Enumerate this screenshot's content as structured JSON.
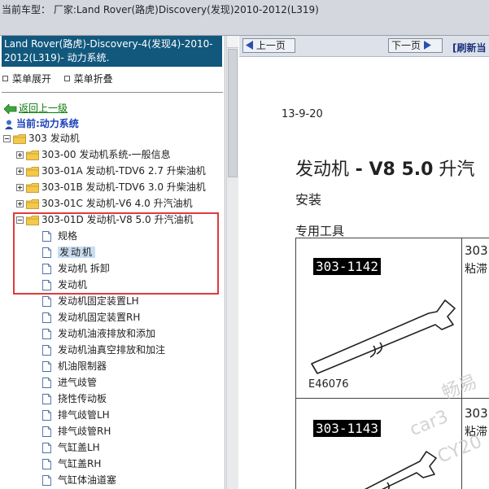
{
  "topbar": {
    "vehicle_label": "当前车型：  厂家:Land Rover(路虎)Discovery(发现)2010-2012(L319)"
  },
  "left_panel": {
    "title": "Land Rover(路虎)-Discovery-4(发现4)-2010-2012(L319)- 动力系统.",
    "expand_label": "菜单展开",
    "collapse_label": "菜单折叠",
    "back_label": "返回上一级",
    "current_label": "当前:动力系统",
    "tree": [
      {
        "label": "303 发动机",
        "level": 0,
        "kind": "folder",
        "expanded": true
      },
      {
        "label": "303-00 发动机系统-一般信息",
        "level": 1,
        "kind": "folder",
        "expanded": false
      },
      {
        "label": "303-01A 发动机-TDV6 2.7 升柴油机",
        "level": 1,
        "kind": "folder",
        "expanded": false
      },
      {
        "label": "303-01B 发动机-TDV6 3.0 升柴油机",
        "level": 1,
        "kind": "folder",
        "expanded": false
      },
      {
        "label": "303-01C 发动机-V6 4.0 升汽油机",
        "level": 1,
        "kind": "folder",
        "expanded": false
      },
      {
        "label": "303-01D 发动机-V8 5.0 升汽油机",
        "level": 1,
        "kind": "folder",
        "expanded": true
      },
      {
        "label": "规格",
        "level": 2,
        "kind": "page"
      },
      {
        "label": "发动机",
        "level": 2,
        "kind": "page",
        "selected": true
      },
      {
        "label": "发动机 拆卸",
        "level": 2,
        "kind": "page"
      },
      {
        "label": "发动机",
        "level": 2,
        "kind": "page"
      },
      {
        "label": "发动机固定装置LH",
        "level": 2,
        "kind": "page"
      },
      {
        "label": "发动机固定装置RH",
        "level": 2,
        "kind": "page"
      },
      {
        "label": "发动机油液排放和添加",
        "level": 2,
        "kind": "page"
      },
      {
        "label": "发动机油真空排放和加注",
        "level": 2,
        "kind": "page"
      },
      {
        "label": "机油限制器",
        "level": 2,
        "kind": "page"
      },
      {
        "label": "进气歧管",
        "level": 2,
        "kind": "page"
      },
      {
        "label": "挠性传动板",
        "level": 2,
        "kind": "page"
      },
      {
        "label": "排气歧管LH",
        "level": 2,
        "kind": "page"
      },
      {
        "label": "排气歧管RH",
        "level": 2,
        "kind": "page"
      },
      {
        "label": "气缸盖LH",
        "level": 2,
        "kind": "page"
      },
      {
        "label": "气缸盖RH",
        "level": 2,
        "kind": "page"
      },
      {
        "label": "气缸体油道塞",
        "level": 2,
        "kind": "page"
      }
    ]
  },
  "right_panel": {
    "prev_label": "上一页",
    "next_label": "下一页",
    "refresh_label": "[刷新当",
    "doc_date": "13-9-20",
    "doc_title_prefix": "发动机",
    "doc_title_bold": " - V8 5.0",
    "doc_title_suffix": " 升汽",
    "doc_subtitle": "安装",
    "special_tools_label": "专用工具",
    "tools": [
      {
        "id": "303-1142",
        "number": "303",
        "desc": "粘滞",
        "figure_code": "E46076"
      },
      {
        "id": "303-1143",
        "number": "303",
        "desc": "粘滞"
      }
    ]
  },
  "watermark": {
    "line1": "畅易",
    "line2": "car3",
    "line3": "CY20"
  },
  "colors": {
    "title_bg": "#12587d",
    "highlight_border": "#e03a3a",
    "link_green": "#0d7a0d",
    "current_blue": "#1a3fb8"
  }
}
